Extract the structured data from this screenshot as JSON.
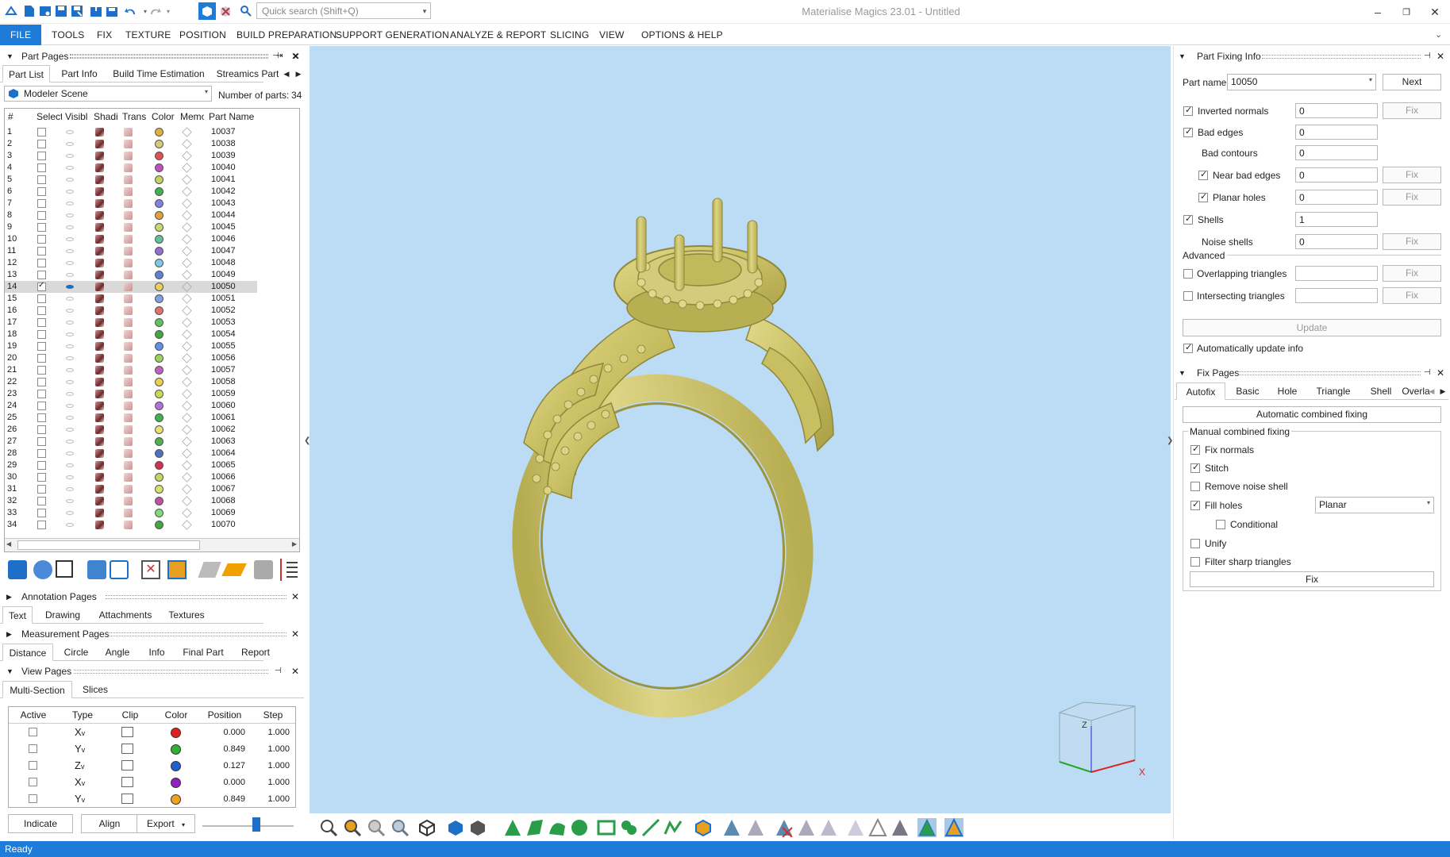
{
  "app": {
    "title": "Materialise Magics 23.01 - Untitled",
    "search_placeholder": "Quick search (Shift+Q)"
  },
  "menubar": [
    "FILE",
    "TOOLS",
    "FIX",
    "TEXTURE",
    "POSITION",
    "BUILD PREPARATION",
    "SUPPORT GENERATION",
    "ANALYZE & REPORT",
    "SLICING",
    "VIEW",
    "OPTIONS & HELP"
  ],
  "part_pages": {
    "title": "Part Pages",
    "tabs": [
      "Part List",
      "Part Info",
      "Build Time Estimation",
      "Streamics Part"
    ],
    "scene": "Modeler Scene",
    "num_parts_label": "Number of parts:",
    "num_parts": "34",
    "columns": [
      "#",
      "Select",
      "Visibl",
      "Shadi",
      "Trans",
      "Color",
      "Memo",
      "Part Name"
    ],
    "rows": [
      {
        "n": "1",
        "name": "10037",
        "color": "#e0b040",
        "sel": false
      },
      {
        "n": "2",
        "name": "10038",
        "color": "#d8c878",
        "sel": false
      },
      {
        "n": "3",
        "name": "10039",
        "color": "#e05050",
        "sel": false
      },
      {
        "n": "4",
        "name": "10040",
        "color": "#c050c0",
        "sel": false
      },
      {
        "n": "5",
        "name": "10041",
        "color": "#c8d060",
        "sel": false
      },
      {
        "n": "6",
        "name": "10042",
        "color": "#40b050",
        "sel": false
      },
      {
        "n": "7",
        "name": "10043",
        "color": "#8080e0",
        "sel": false
      },
      {
        "n": "8",
        "name": "10044",
        "color": "#e0a040",
        "sel": false
      },
      {
        "n": "9",
        "name": "10045",
        "color": "#c8d870",
        "sel": false
      },
      {
        "n": "10",
        "name": "10046",
        "color": "#60c0a0",
        "sel": false
      },
      {
        "n": "11",
        "name": "10047",
        "color": "#9070d0",
        "sel": false
      },
      {
        "n": "12",
        "name": "10048",
        "color": "#80c8e8",
        "sel": false
      },
      {
        "n": "13",
        "name": "10049",
        "color": "#6080d0",
        "sel": false
      },
      {
        "n": "14",
        "name": "10050",
        "color": "#e8d060",
        "sel": true
      },
      {
        "n": "15",
        "name": "10051",
        "color": "#80a0e0",
        "sel": false
      },
      {
        "n": "16",
        "name": "10052",
        "color": "#e07070",
        "sel": false
      },
      {
        "n": "17",
        "name": "10053",
        "color": "#60c060",
        "sel": false
      },
      {
        "n": "18",
        "name": "10054",
        "color": "#40a840",
        "sel": false
      },
      {
        "n": "19",
        "name": "10055",
        "color": "#6090e0",
        "sel": false
      },
      {
        "n": "20",
        "name": "10056",
        "color": "#a0d060",
        "sel": false
      },
      {
        "n": "21",
        "name": "10057",
        "color": "#c060c0",
        "sel": false
      },
      {
        "n": "22",
        "name": "10058",
        "color": "#e8d050",
        "sel": false
      },
      {
        "n": "23",
        "name": "10059",
        "color": "#c8d858",
        "sel": false
      },
      {
        "n": "24",
        "name": "10060",
        "color": "#b070e0",
        "sel": false
      },
      {
        "n": "25",
        "name": "10061",
        "color": "#40b050",
        "sel": false
      },
      {
        "n": "26",
        "name": "10062",
        "color": "#e8e070",
        "sel": false
      },
      {
        "n": "27",
        "name": "10063",
        "color": "#50b050",
        "sel": false
      },
      {
        "n": "28",
        "name": "10064",
        "color": "#5070c0",
        "sel": false
      },
      {
        "n": "29",
        "name": "10065",
        "color": "#d03050",
        "sel": false
      },
      {
        "n": "30",
        "name": "10066",
        "color": "#c0d860",
        "sel": false
      },
      {
        "n": "31",
        "name": "10067",
        "color": "#d8e070",
        "sel": false
      },
      {
        "n": "32",
        "name": "10068",
        "color": "#c050a0",
        "sel": false
      },
      {
        "n": "33",
        "name": "10069",
        "color": "#80d880",
        "sel": false
      },
      {
        "n": "34",
        "name": "10070",
        "color": "#40a840",
        "sel": false
      }
    ]
  },
  "annotation_pages": {
    "title": "Annotation Pages",
    "tabs": [
      "Text",
      "Drawing",
      "Attachments",
      "Textures"
    ]
  },
  "measurement_pages": {
    "title": "Measurement Pages",
    "tabs": [
      "Distance",
      "Circle",
      "Angle",
      "Info",
      "Final Part",
      "Report"
    ]
  },
  "view_pages": {
    "title": "View Pages",
    "tabs": [
      "Multi-Section",
      "Slices"
    ],
    "columns": [
      "Active",
      "Type",
      "Clip",
      "Color",
      "Position",
      "Step"
    ],
    "rows": [
      {
        "type": "X",
        "color": "#e02020",
        "position": "0.000",
        "step": "1.000"
      },
      {
        "type": "Y",
        "color": "#30b030",
        "position": "0.849",
        "step": "1.000"
      },
      {
        "type": "Z",
        "color": "#2060d0",
        "position": "0.127",
        "step": "1.000"
      },
      {
        "type": "X",
        "color": "#9020c0",
        "position": "0.000",
        "step": "1.000"
      },
      {
        "type": "Y",
        "color": "#f0a020",
        "position": "0.849",
        "step": "1.000"
      }
    ],
    "buttons": {
      "indicate": "Indicate",
      "align": "Align",
      "export": "Export"
    }
  },
  "part_fixing": {
    "title": "Part Fixing Info",
    "part_name_label": "Part name",
    "part_name": "10050",
    "next": "Next",
    "items": [
      {
        "label": "Inverted normals",
        "value": "0",
        "checked": true,
        "fix": true,
        "indent": false,
        "cb": true
      },
      {
        "label": "Bad edges",
        "value": "0",
        "checked": true,
        "fix": false,
        "indent": false,
        "cb": true
      },
      {
        "label": "Bad contours",
        "value": "0",
        "checked": false,
        "fix": false,
        "indent": true,
        "cb": false
      },
      {
        "label": "Near bad edges",
        "value": "0",
        "checked": true,
        "fix": true,
        "indent": true,
        "cb": true
      },
      {
        "label": "Planar holes",
        "value": "0",
        "checked": true,
        "fix": true,
        "indent": true,
        "cb": true
      },
      {
        "label": "Shells",
        "value": "1",
        "checked": true,
        "fix": false,
        "indent": false,
        "cb": true
      },
      {
        "label": "Noise shells",
        "value": "0",
        "checked": false,
        "fix": true,
        "indent": true,
        "cb": false
      }
    ],
    "advanced_label": "Advanced",
    "advanced": [
      {
        "label": "Overlapping triangles",
        "value": "",
        "checked": false
      },
      {
        "label": "Intersecting triangles",
        "value": "",
        "checked": false
      }
    ],
    "fix_label": "Fix",
    "update": "Update",
    "auto_update": "Automatically update info"
  },
  "fix_pages": {
    "title": "Fix Pages",
    "tabs": [
      "Autofix",
      "Basic",
      "Hole",
      "Triangle",
      "Shell",
      "Overla"
    ],
    "auto_combined": "Automatic combined fixing",
    "manual_group": "Manual combined fixing",
    "options": [
      {
        "label": "Fix normals",
        "checked": true,
        "indent": false
      },
      {
        "label": "Stitch",
        "checked": true,
        "indent": false
      },
      {
        "label": "Remove noise shell",
        "checked": false,
        "indent": false
      },
      {
        "label": "Fill holes",
        "checked": true,
        "indent": false
      },
      {
        "label": "Conditional",
        "checked": false,
        "indent": true
      },
      {
        "label": "Unify",
        "checked": false,
        "indent": false
      },
      {
        "label": "Filter sharp triangles",
        "checked": false,
        "indent": false
      }
    ],
    "fill_mode": "Planar",
    "fix": "Fix"
  },
  "viewcube": {
    "z": "Z",
    "x": "X"
  },
  "status": "Ready",
  "colors": {
    "accent": "#1e7bd8",
    "viewport": "#bbdcf4",
    "ring": "#c9c06a"
  }
}
